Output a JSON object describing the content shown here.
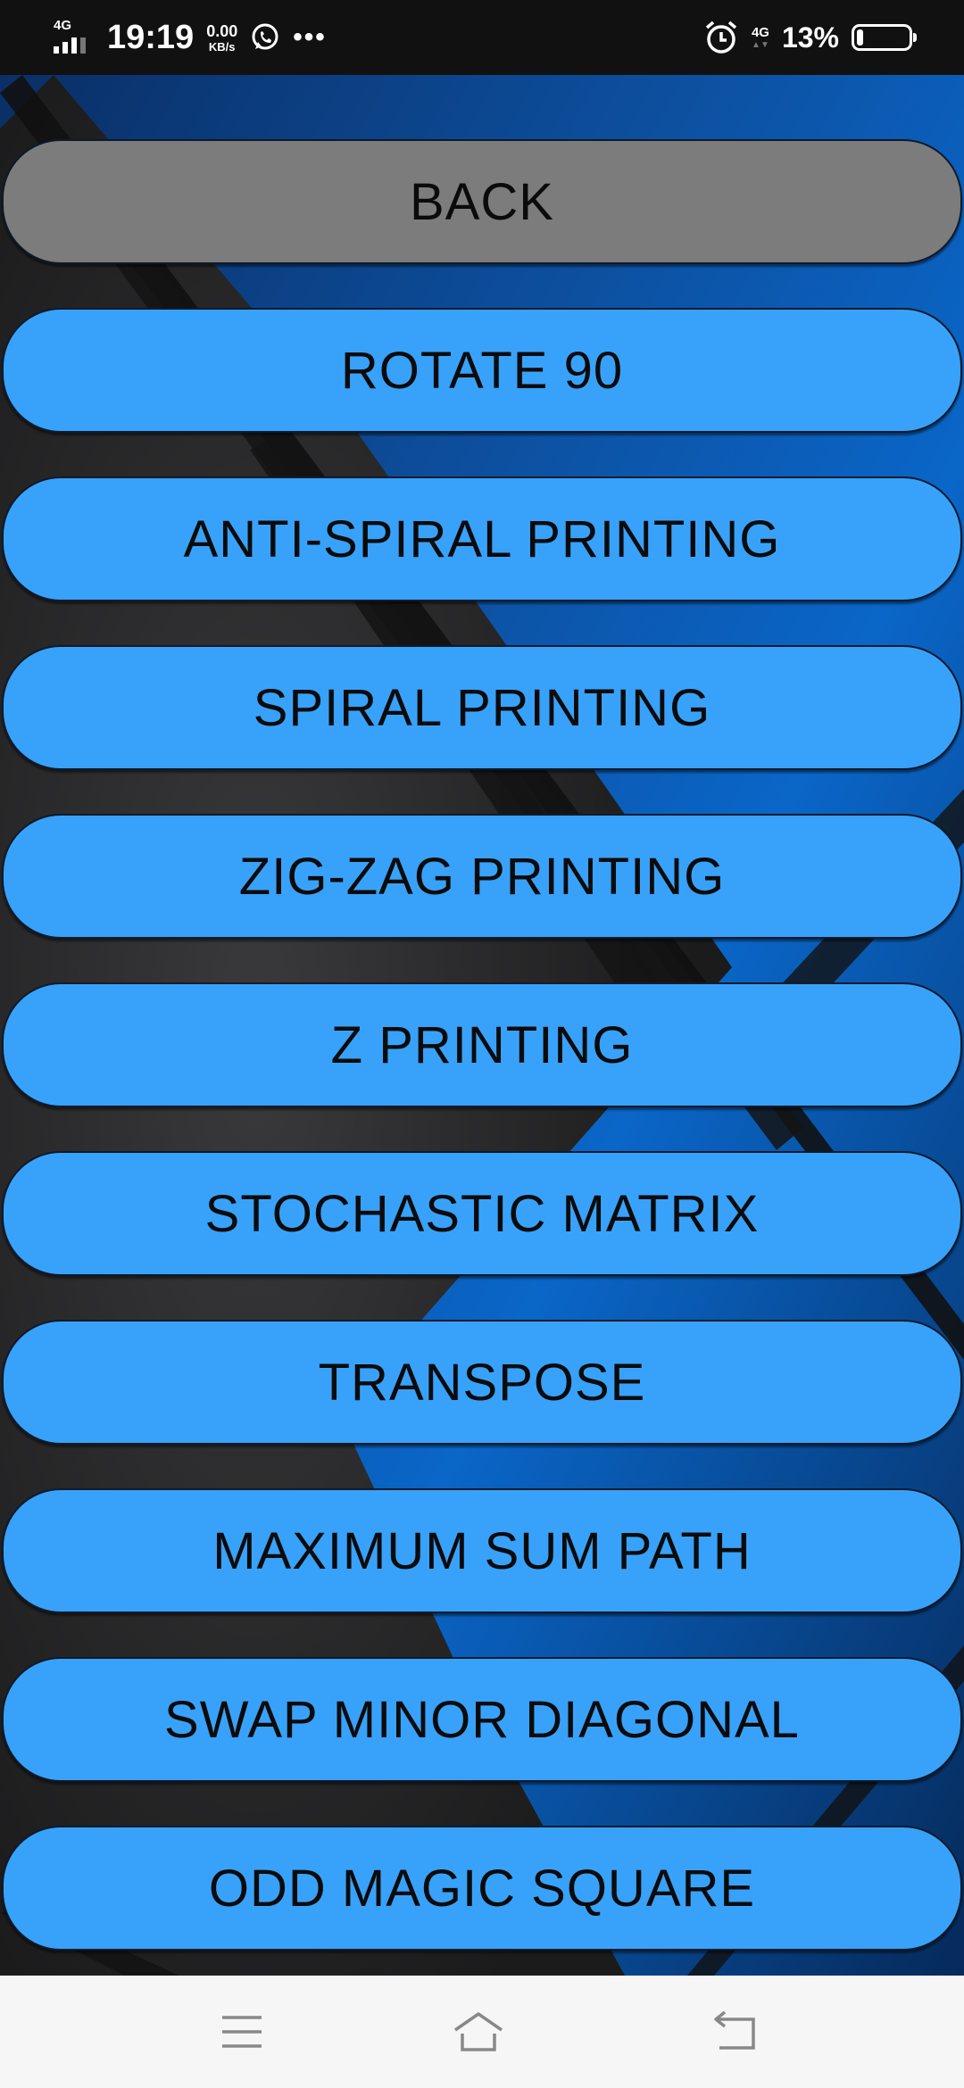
{
  "status_bar": {
    "network_left": "4G",
    "time": "19:19",
    "speed_value": "0.00",
    "speed_unit": "KB/s",
    "more": "•••",
    "network_right": "4G",
    "battery_percent": "13%",
    "battery_level": 0.13,
    "icons": [
      "signal-icon",
      "whatsapp-icon",
      "alarm-icon",
      "battery-icon"
    ]
  },
  "menu": {
    "buttons": [
      {
        "label": "BACK"
      },
      {
        "label": "ROTATE 90"
      },
      {
        "label": "ANTI-SPIRAL PRINTING"
      },
      {
        "label": "SPIRAL PRINTING"
      },
      {
        "label": "ZIG-ZAG PRINTING"
      },
      {
        "label": "Z PRINTING"
      },
      {
        "label": "STOCHASTIC MATRIX"
      },
      {
        "label": "TRANSPOSE"
      },
      {
        "label": "MAXIMUM SUM PATH"
      },
      {
        "label": "SWAP MINOR DIAGONAL"
      },
      {
        "label": "ODD MAGIC SQUARE"
      }
    ]
  },
  "colors": {
    "button_primary": "#38a2fb",
    "button_back": "#7c7c7c",
    "status_bar": "#111111",
    "nav_bar": "#f6f6f6"
  },
  "nav_bar": {
    "icons": [
      "menu-icon",
      "home-icon",
      "back-icon"
    ]
  }
}
